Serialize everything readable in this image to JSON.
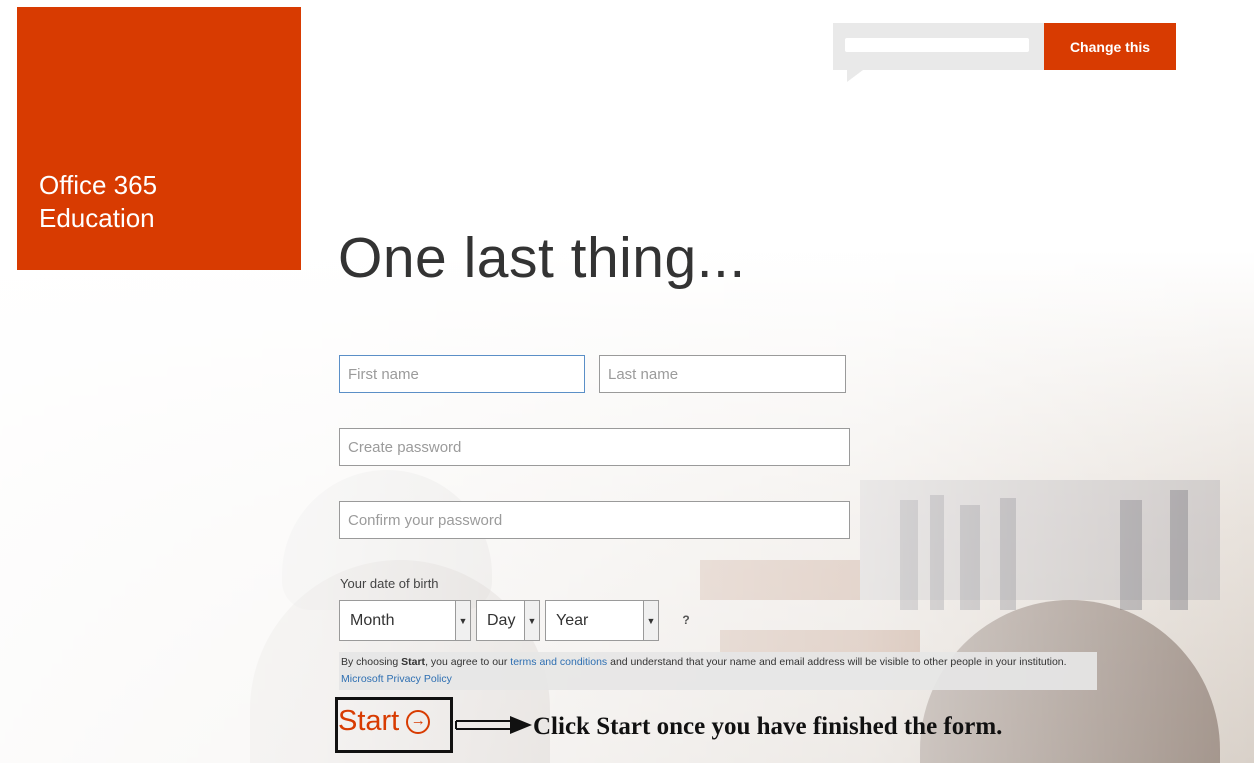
{
  "brand": {
    "line1": "Office 365",
    "line2": "Education",
    "color": "#d83b01"
  },
  "top_bar": {
    "change_button": "Change this"
  },
  "main": {
    "title": "One last thing..."
  },
  "form": {
    "first_name_placeholder": "First name",
    "last_name_placeholder": "Last name",
    "password_placeholder": "Create password",
    "confirm_password_placeholder": "Confirm your password",
    "dob_label": "Your date of birth",
    "month_value": "Month",
    "day_value": "Day",
    "year_value": "Year",
    "help_icon": "?",
    "terms": {
      "prefix": "By choosing ",
      "start_word": "Start",
      "mid1": ", you agree to our ",
      "terms_link": "terms and conditions",
      "mid2": " and understand that your name and email address will be visible to other people in your institution. ",
      "privacy_link": "Microsoft Privacy Policy"
    },
    "start_label": "Start"
  },
  "annotation": {
    "text": "Click Start once you have finished the form."
  },
  "icons": {
    "help": "question-icon",
    "start_arrow": "arrow-right-circle-icon",
    "dropdown": "chevron-down-icon"
  }
}
